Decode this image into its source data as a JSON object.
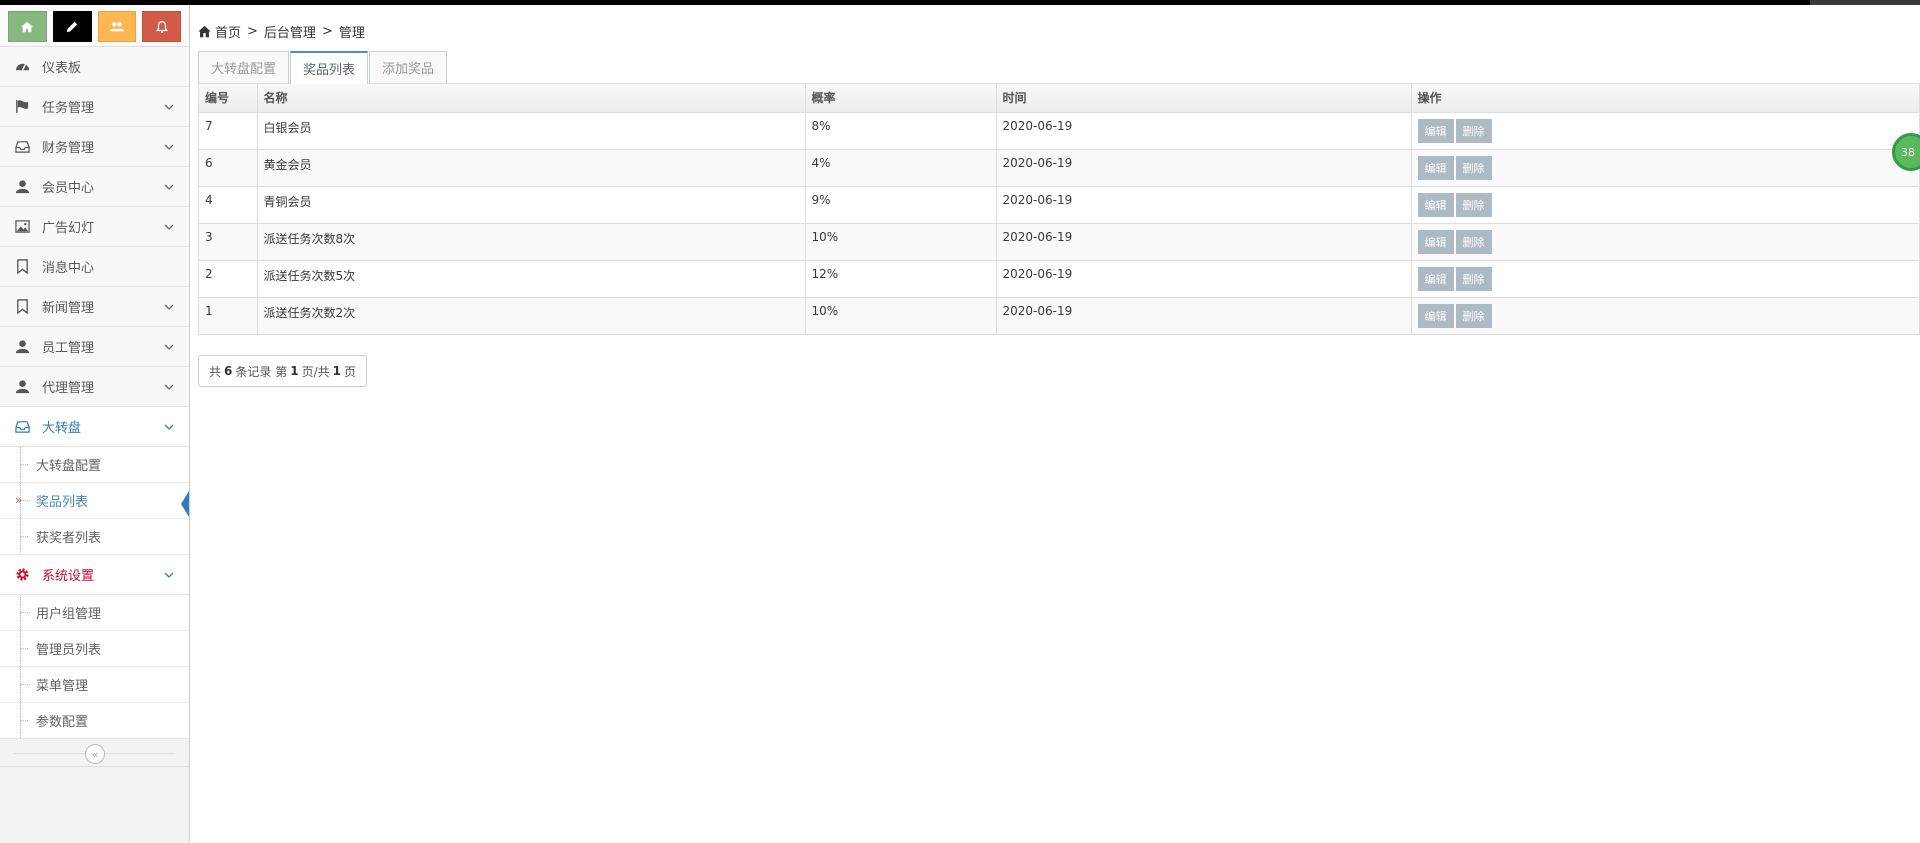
{
  "shortcuts": [
    {
      "icon": "home-icon",
      "color": "#87b87f"
    },
    {
      "icon": "pencil-icon",
      "color": "#000000"
    },
    {
      "icon": "users-icon",
      "color": "#ffb752"
    },
    {
      "icon": "bell-icon",
      "color": "#d15b47"
    }
  ],
  "sidebar": {
    "items": [
      {
        "label": "仪表板",
        "icon": "dashboard-icon"
      },
      {
        "label": "任务管理",
        "icon": "flag-icon"
      },
      {
        "label": "财务管理",
        "icon": "inbox-icon"
      },
      {
        "label": "会员中心",
        "icon": "user-icon"
      },
      {
        "label": "广告幻灯",
        "icon": "picture-icon"
      },
      {
        "label": "消息中心",
        "icon": "bookmark-icon"
      },
      {
        "label": "新闻管理",
        "icon": "bookmark-icon"
      },
      {
        "label": "员工管理",
        "icon": "user-icon"
      },
      {
        "label": "代理管理",
        "icon": "user-icon"
      },
      {
        "label": "大转盘",
        "icon": "inbox-icon"
      },
      {
        "label": "系统设置",
        "icon": "gear-icon"
      }
    ],
    "wheel_sub": [
      "大转盘配置",
      "奖品列表",
      "获奖者列表"
    ],
    "system_sub": [
      "用户组管理",
      "管理员列表",
      "菜单管理",
      "参数配置"
    ],
    "collapse_glyph": "«"
  },
  "breadcrumb": {
    "home": "首页",
    "sep": ">",
    "b2": "后台管理",
    "b3": "管理"
  },
  "tabs": [
    "大转盘配置",
    "奖品列表",
    "添加奖品"
  ],
  "table": {
    "headers": [
      "编号",
      "名称",
      "概率",
      "时间",
      "操作"
    ],
    "rows": [
      {
        "id": "7",
        "name": "白银会员",
        "rate": "8%",
        "time": "2020-06-19"
      },
      {
        "id": "6",
        "name": "黄金会员",
        "rate": "4%",
        "time": "2020-06-19"
      },
      {
        "id": "4",
        "name": "青铜会员",
        "rate": "9%",
        "time": "2020-06-19"
      },
      {
        "id": "3",
        "name": "派送任务次数8次",
        "rate": "10%",
        "time": "2020-06-19"
      },
      {
        "id": "2",
        "name": "派送任务次数5次",
        "rate": "12%",
        "time": "2020-06-19"
      },
      {
        "id": "1",
        "name": "派送任务次数2次",
        "rate": "10%",
        "time": "2020-06-19"
      }
    ],
    "edit_label": "编辑",
    "delete_label": "删除"
  },
  "pager": {
    "p1": "共",
    "total": "6",
    "p2": "条记录 第",
    "page": "1",
    "p3": "页/共",
    "pages": "1",
    "p4": "页"
  },
  "badge": "38",
  "colors": {
    "accent": "#2b7dbc",
    "system": "#c6112b",
    "button": "#abbac3"
  }
}
